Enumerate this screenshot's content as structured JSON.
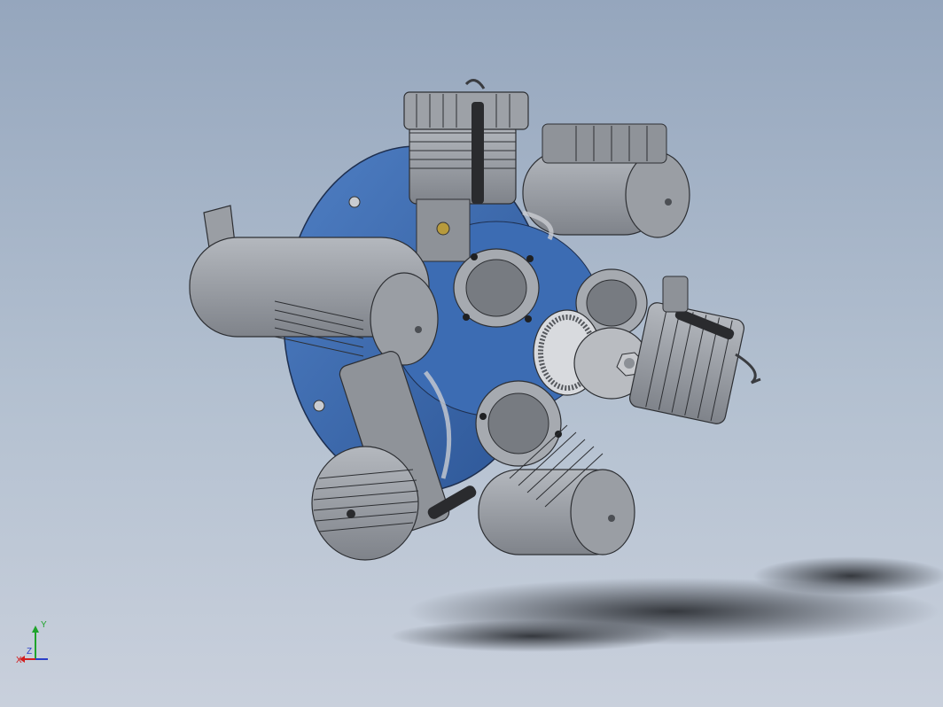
{
  "viewport": {
    "background_top": "#95a6bd",
    "background_bottom": "#c9d0dc"
  },
  "model": {
    "kind": "radial-engine-3-cylinder-assembly",
    "colors": {
      "body_grey": "#8d9197",
      "dark_grey": "#5f6369",
      "crankcase_blue": "#3b68ad",
      "shadow": "#3a3d43"
    }
  },
  "triad": {
    "y_label": "Y",
    "z_label": "Z",
    "x_label": "X",
    "y_color": "#1fa32b",
    "x_color": "#d21f1f",
    "z_color": "#2a3fc8"
  }
}
